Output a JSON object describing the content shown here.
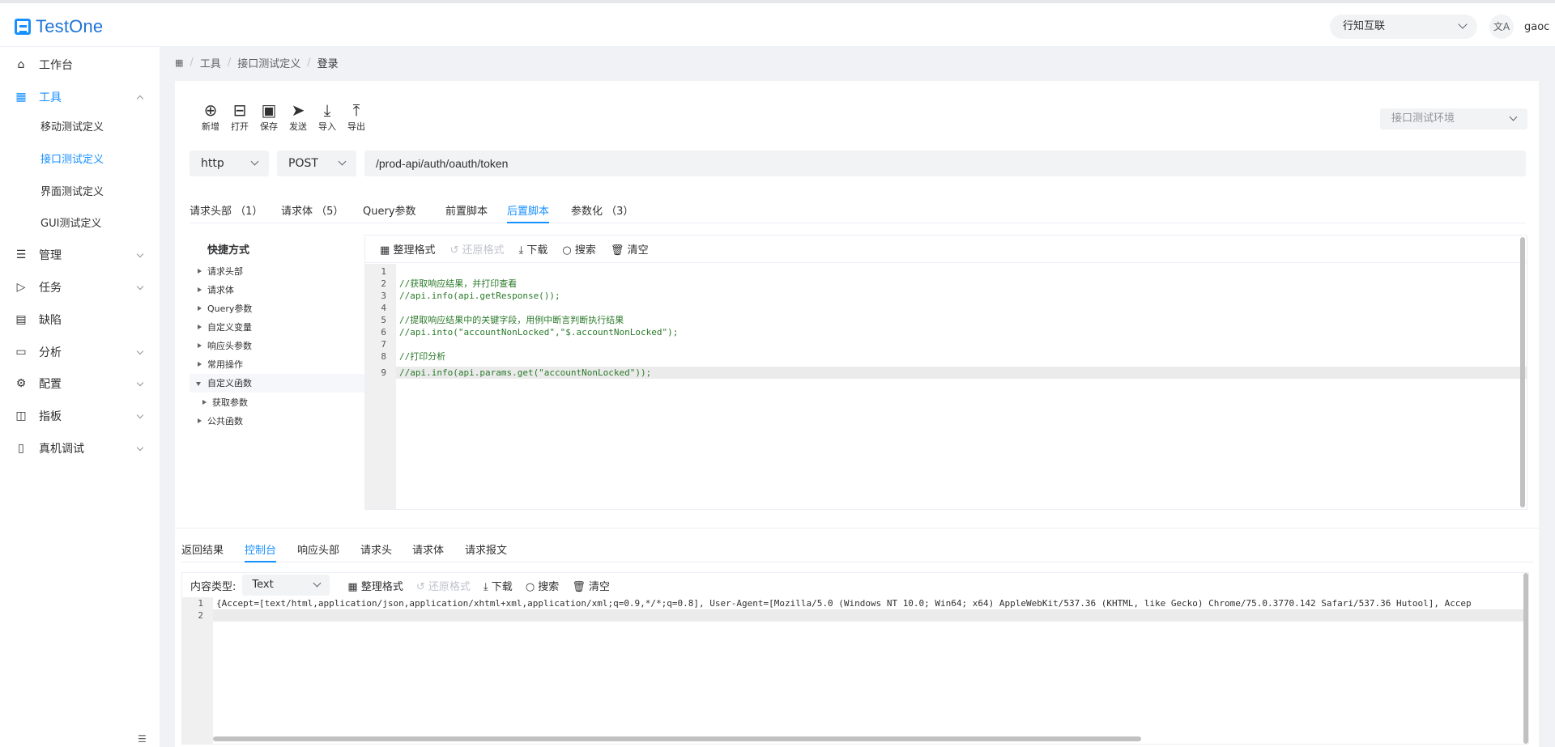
{
  "header": {
    "logo_text": "TestOne",
    "org_select": "行知互联",
    "lang_icon": "文A",
    "user_name": "gaoc"
  },
  "sidebar": {
    "items": [
      {
        "label": "工作台",
        "icon": "home-icon"
      },
      {
        "label": "工具",
        "icon": "grid-icon"
      },
      {
        "label": "管理",
        "icon": "list-icon"
      },
      {
        "label": "任务",
        "icon": "send-icon"
      },
      {
        "label": "缺陷",
        "icon": "document-icon"
      },
      {
        "label": "分析",
        "icon": "calendar-icon"
      },
      {
        "label": "配置",
        "icon": "gear-icon"
      },
      {
        "label": "指板",
        "icon": "panel-icon"
      },
      {
        "label": "真机调试",
        "icon": "device-icon"
      }
    ],
    "sub_items": [
      {
        "label": "移动测试定义"
      },
      {
        "label": "接口测试定义"
      },
      {
        "label": "界面测试定义"
      },
      {
        "label": "GUI测试定义"
      }
    ]
  },
  "breadcrumb": {
    "items": [
      "工具",
      "接口测试定义",
      "登录"
    ]
  },
  "toolbar": {
    "buttons": [
      {
        "label": "新增",
        "icon": "plus-circle-icon"
      },
      {
        "label": "打开",
        "icon": "tree-icon"
      },
      {
        "label": "保存",
        "icon": "save-icon"
      },
      {
        "label": "发送",
        "icon": "send-icon"
      },
      {
        "label": "导入",
        "icon": "download-icon"
      },
      {
        "label": "导出",
        "icon": "upload-icon"
      }
    ],
    "env_select": "接口测试环境"
  },
  "request": {
    "protocol": "http",
    "method": "POST",
    "url": "/prod-api/auth/oauth/token"
  },
  "req_tabs": [
    {
      "label": "请求头部 （1）"
    },
    {
      "label": "请求体 （5）"
    },
    {
      "label": "Query参数"
    },
    {
      "label": "前置脚本"
    },
    {
      "label": "后置脚本"
    },
    {
      "label": "参数化 （3）"
    }
  ],
  "quick": {
    "title": "快捷方式",
    "items": [
      {
        "label": "请求头部"
      },
      {
        "label": "请求体"
      },
      {
        "label": "Query参数"
      },
      {
        "label": "自定义变量"
      },
      {
        "label": "响应头参数"
      },
      {
        "label": "常用操作"
      },
      {
        "label": "自定义函数"
      },
      {
        "label": "获取参数"
      },
      {
        "label": "公共函数"
      }
    ]
  },
  "editor_toolbar": {
    "format": "整理格式",
    "restore": "还原格式",
    "download": "下载",
    "search": "搜索",
    "clear": "清空"
  },
  "editor": {
    "line_numbers": [
      "1",
      "2",
      "3",
      "4",
      "5",
      "6",
      "7",
      "8",
      "9"
    ],
    "lines": [
      "",
      "//获取响应结果，并打印查看",
      "//api.info(api.getResponse());",
      "",
      "//提取响应结果中的关键字段，用例中断言判断执行结果",
      "//api.into(\"accountNonLocked\",\"$.accountNonLocked\");",
      "",
      "//打印分析",
      "//api.info(api.params.get(\"accountNonLocked\"));"
    ]
  },
  "res_tabs": [
    {
      "label": "返回结果"
    },
    {
      "label": "控制台"
    },
    {
      "label": "响应头部"
    },
    {
      "label": "请求头"
    },
    {
      "label": "请求体"
    },
    {
      "label": "请求报文"
    }
  ],
  "console": {
    "content_type_label": "内容类型:",
    "content_type": "Text",
    "format": "整理格式",
    "restore": "还原格式",
    "download": "下载",
    "search": "搜索",
    "clear": "清空",
    "line_numbers": [
      "1",
      "2"
    ],
    "line1": "{Accept=[text/html,application/json,application/xhtml+xml,application/xml;q=0.9,*/*;q=0.8], User-Agent=[Mozilla/5.0 (Windows NT 10.0; Win64; x64) AppleWebKit/537.36 (KHTML, like Gecko) Chrome/75.0.3770.142 Safari/537.36 Hutool], Accep"
  },
  "colors": {
    "accent": "#1890ff",
    "code_comment": "#2a7a2a"
  }
}
